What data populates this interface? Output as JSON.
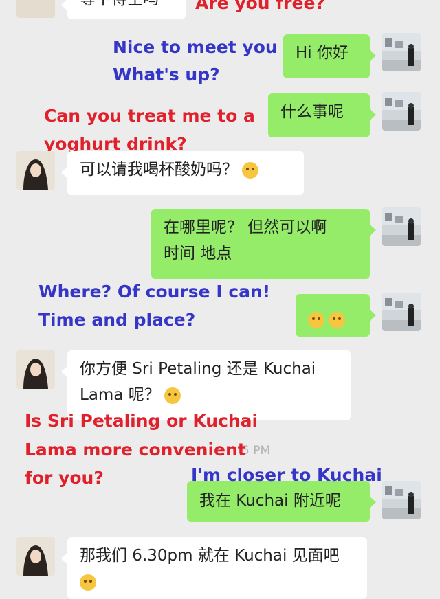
{
  "messages": {
    "m0": {
      "text": "等下得空吗"
    },
    "m1": {
      "text": "Hi 你好"
    },
    "m2": {
      "text": "什么事呢"
    },
    "m3": {
      "text": "可以请我喝杯酸奶吗？"
    },
    "m4": {
      "line1": "在哪里呢？ 但然可以啊",
      "line2": "时间 地点"
    },
    "m6": {
      "line1": "你方便 Sri Petaling 还是 Kuchai",
      "line2": "Lama 呢？"
    },
    "m7": {
      "text": "我在 Kuchai 附近呢"
    },
    "m8": {
      "text": "那我们 6.30pm 就在 Kuchai 见面吧"
    }
  },
  "timestamp": "5 PM",
  "captions": {
    "c0": "Are you free?",
    "c1": "Nice to meet you",
    "c2": "What's up?",
    "c3": "Can you treat me to a",
    "c4": "yoghurt drink?",
    "c5": "Where? Of course I can!",
    "c6": "Time and place?",
    "c7": "Is Sri Petaling or Kuchai",
    "c8": "Lama more convenient",
    "c9": "for you?",
    "c10": "I'm closer to Kuchai"
  },
  "colors": {
    "green_bubble": "#95ec69",
    "white_bubble": "#ffffff",
    "caption_blue": "#3535c8",
    "caption_red": "#e0202a",
    "background": "#ececec"
  },
  "icons": {
    "emoji_shy": "flushed-face",
    "emoji_smile": "smiling-face",
    "emoji_think": "thinking-face"
  }
}
